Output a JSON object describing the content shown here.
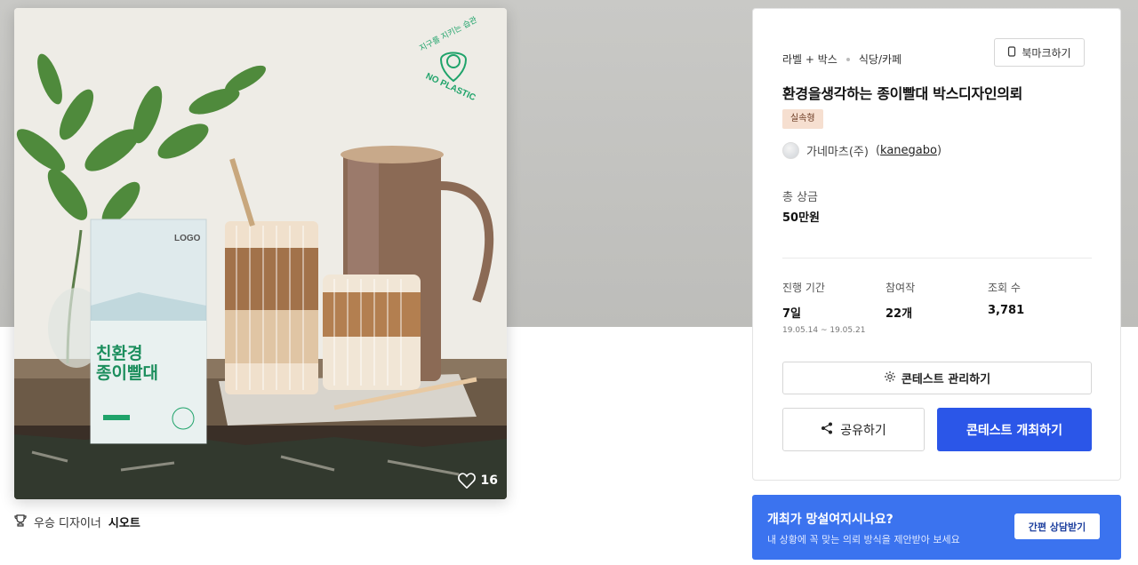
{
  "gallery": {
    "image_description_text": {
      "logo_text": "LOGO",
      "box_title_line1": "친환경",
      "box_title_line2": "종이빨대",
      "badge_top": "지구를 지키는 습관",
      "badge_bottom": "NO PLASTIC"
    },
    "like_count": "16"
  },
  "winner": {
    "prefix": "우승 디자이너",
    "name": "시오트"
  },
  "contest": {
    "categories": [
      "라벨 + 박스",
      "식당/카페"
    ],
    "bookmark_label": "북마크하기",
    "title": "환경을생각하는 종이빨대 박스디자인의뢰",
    "type_badge": "실속형",
    "host_name": "가네마츠(주)",
    "host_handle": "kanegabo",
    "prize_label": "총 상금",
    "prize_value": "50만원",
    "stats": {
      "duration_label": "진행 기간",
      "duration_value": "7일",
      "duration_range": "19.05.14 ~ 19.05.21",
      "entries_label": "참여작",
      "entries_value": "22개",
      "views_label": "조회 수",
      "views_value": "3,781"
    },
    "manage_label": "콘테스트 관리하기",
    "share_label": "공유하기",
    "host_label": "콘테스트 개최하기"
  },
  "consult": {
    "question": "개최가 망설여지시나요?",
    "description": "내 상황에 꼭 맞는 의뢰 방식을 제안받아 보세요",
    "button_label": "간편 상담받기"
  },
  "colors": {
    "primary_button": "#2b56e8",
    "consult_banner": "#3b73ef",
    "badge_bg": "#f6dfd0",
    "brand_green": "#1fa36a"
  }
}
